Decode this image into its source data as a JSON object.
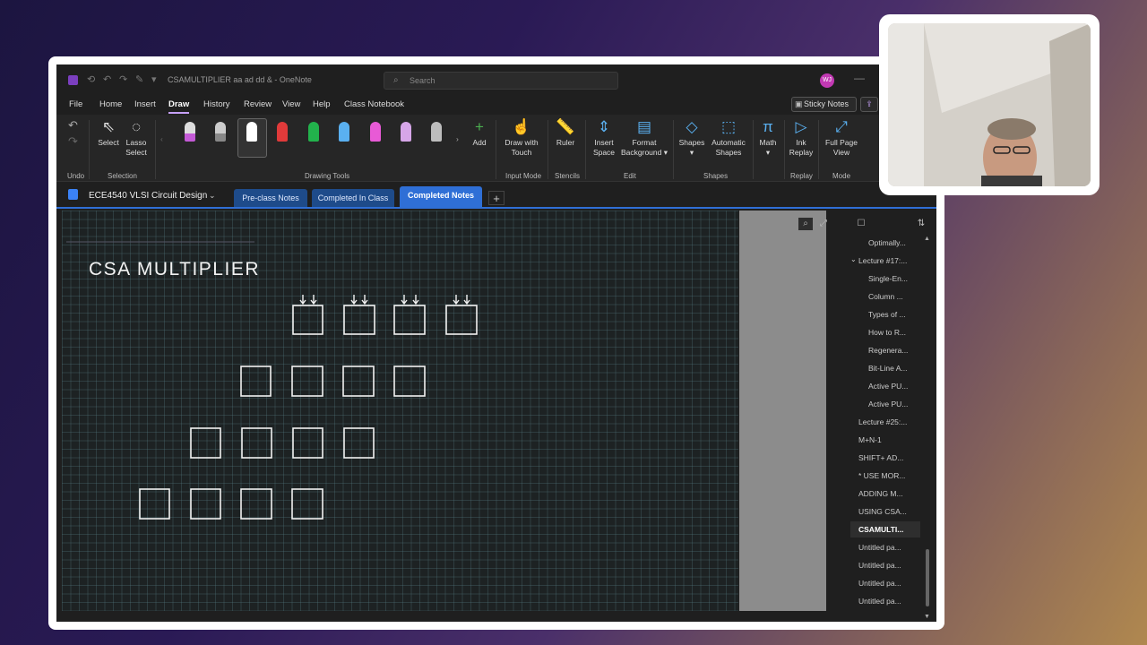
{
  "window": {
    "title": "CSAMULTIPLIER aa ad dd & - OneNote",
    "search_placeholder": "Search",
    "avatar_initials": "WJ"
  },
  "menu": [
    "File",
    "Home",
    "Insert",
    "Draw",
    "History",
    "Review",
    "View",
    "Help",
    "Class Notebook"
  ],
  "active_menu": "Draw",
  "sticky_notes_label": "Sticky Notes",
  "ribbon": {
    "undo_group": "Undo",
    "selection": {
      "select": "Select",
      "lasso_1": "Lasso",
      "lasso_2": "Select",
      "group": "Selection"
    },
    "drawing_tools_group": "Drawing Tools",
    "pens": [
      "#c45ad6",
      "#d0d0d0",
      "#ffffff",
      "#e03a3a",
      "#22b24c",
      "#5ab0f0",
      "#e85ad6",
      "#d6a6e8",
      "#bdbdbd"
    ],
    "add_label": "Add",
    "draw_with_touch_1": "Draw with",
    "draw_with_touch_2": "Touch",
    "input_mode_group": "Input Mode",
    "ruler": "Ruler",
    "stencils_group": "Stencils",
    "insert_space_1": "Insert",
    "insert_space_2": "Space",
    "format_bg_1": "Format",
    "format_bg_2": "Background",
    "edit_group": "Edit",
    "shapes": "Shapes",
    "auto_shapes_1": "Automatic",
    "auto_shapes_2": "Shapes",
    "shapes_group": "Shapes",
    "math": "Math",
    "ink_replay_1": "Ink",
    "ink_replay_2": "Replay",
    "replay_group": "Replay",
    "full_page_1": "Full Page",
    "full_page_2": "View",
    "mode_group": "Mode"
  },
  "notebook": {
    "name": "ECE4540 VLSI Circuit Design",
    "sections": [
      "Pre-class Notes",
      "Completed In Class",
      "Completed Notes"
    ],
    "active_section": "Completed Notes"
  },
  "canvas": {
    "handwritten_title": "CSA MULTIPLIER"
  },
  "pages": [
    {
      "label": "Optimally...",
      "level": "sub"
    },
    {
      "label": "Lecture #17:...",
      "level": "top"
    },
    {
      "label": "Single-En...",
      "level": "sub"
    },
    {
      "label": "Column ...",
      "level": "sub"
    },
    {
      "label": "Types of ...",
      "level": "sub"
    },
    {
      "label": "How to R...",
      "level": "sub"
    },
    {
      "label": "Regenera...",
      "level": "sub"
    },
    {
      "label": "Bit-Line A...",
      "level": "sub"
    },
    {
      "label": "Active PU...",
      "level": "sub"
    },
    {
      "label": "Active PU...",
      "level": "sub"
    },
    {
      "label": "Lecture #25:...",
      "level": "top"
    },
    {
      "label": "M+N-1",
      "level": "top"
    },
    {
      "label": "SHIFT+ AD...",
      "level": "top"
    },
    {
      "label": "* USE MOR...",
      "level": "top"
    },
    {
      "label": "ADDING M...",
      "level": "top"
    },
    {
      "label": "USING CSA...",
      "level": "top"
    },
    {
      "label": "CSAMULTI...",
      "level": "top",
      "active": true
    },
    {
      "label": "Untitled pa...",
      "level": "top"
    },
    {
      "label": "Untitled pa...",
      "level": "top"
    },
    {
      "label": "Untitled pa...",
      "level": "top"
    },
    {
      "label": "Untitled pa...",
      "level": "top"
    }
  ]
}
